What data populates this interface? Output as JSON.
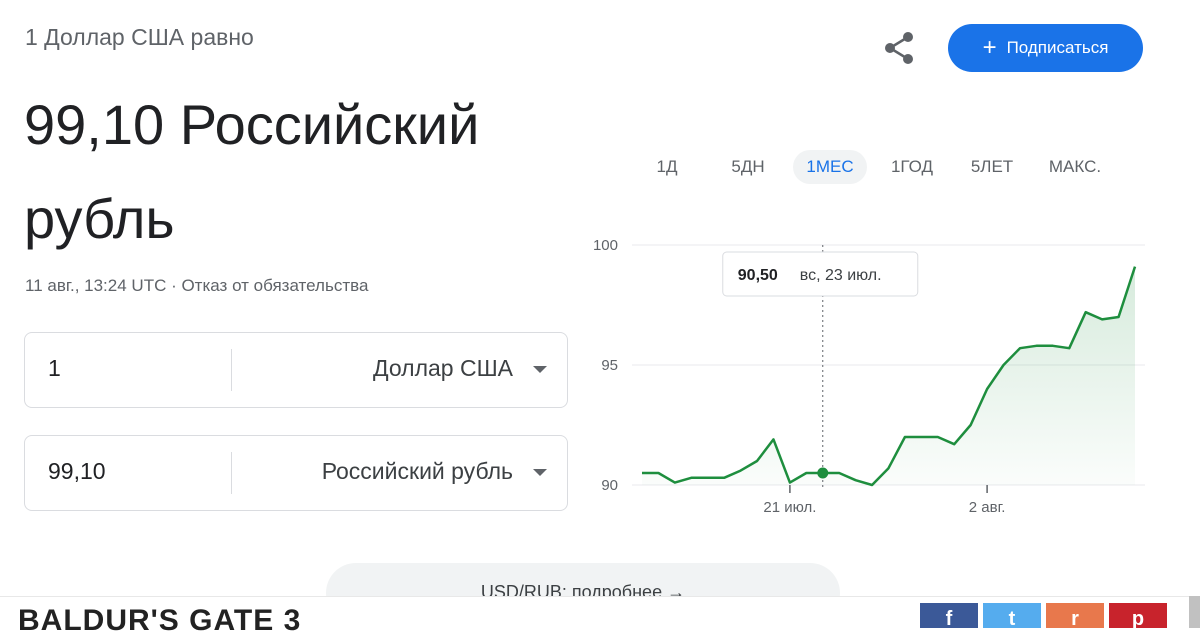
{
  "header": {
    "equals_text": "1 Доллар США равно",
    "rate_value": "99,10 Российский рубль",
    "updated": "11 авг., 13:24 UTC · Отказ от обязательства",
    "subscribe_label": "Подписаться",
    "subscribe_icon": "plus-icon",
    "share_icon": "share-icon"
  },
  "converter": {
    "from": {
      "amount": "1",
      "currency": "Доллар США"
    },
    "to": {
      "amount": "99,10",
      "currency": "Российский рубль"
    }
  },
  "ranges": {
    "tabs": [
      "1Д",
      "5ДН",
      "1МЕС",
      "1ГОД",
      "5ЛЕТ",
      "МАКС."
    ],
    "active": "1МЕС"
  },
  "tooltip": {
    "value": "90,50",
    "date": "вс, 23 июл."
  },
  "details_label": "USD/RUB: подробнее →",
  "bottom": {
    "title": "BALDUR'S GATE 3",
    "social": [
      {
        "label": "f",
        "color": "#3b5998"
      },
      {
        "label": "t",
        "color": "#55acee"
      },
      {
        "label": "r",
        "color": "#e8784c"
      },
      {
        "label": "p",
        "color": "#c8232c"
      }
    ]
  },
  "colors": {
    "accent": "#1a73e8",
    "line": "#1e8e3e"
  },
  "chart_data": {
    "type": "line",
    "title": "",
    "xlabel": "",
    "ylabel": "",
    "ylim": [
      90,
      100
    ],
    "yticks": [
      90,
      95,
      100
    ],
    "xticks": [
      "21 июл.",
      "2 авг."
    ],
    "grid": true,
    "highlight_index": 11,
    "series": [
      {
        "values": [
          90.5,
          90.5,
          90.1,
          90.3,
          90.3,
          90.3,
          90.6,
          91.0,
          91.9,
          90.1,
          90.5,
          90.5,
          90.5,
          90.2,
          90.0,
          90.7,
          92.0,
          92.0,
          92.0,
          91.7,
          92.5,
          94.0,
          95.0,
          95.7,
          95.8,
          95.8,
          95.7,
          97.2,
          96.9,
          97.0,
          99.1
        ]
      }
    ],
    "x_tick_indices": [
      9,
      21
    ]
  }
}
